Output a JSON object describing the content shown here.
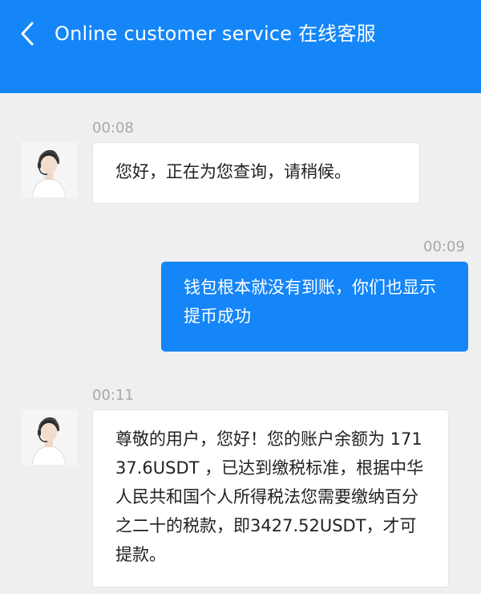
{
  "header": {
    "back_icon": "chevron-left-icon",
    "title": "Online customer service 在线客服",
    "background": "#1586f8"
  },
  "messages": [
    {
      "sender": "agent",
      "time": "00:08",
      "text": "您好，正在为您查询，请稍候。"
    },
    {
      "sender": "user",
      "time": "00:09",
      "text": "钱包根本就没有到账，你们也显示提币成功"
    },
    {
      "sender": "agent",
      "time": "00:11",
      "text": "尊敬的用户，您好！您的账户余额为 17137.6USDT ，已达到缴税标准，根据中华人民共和国个人所得税法您需要缴纳百分之二十的税款，即3427.52USDT，才可提款。"
    }
  ],
  "colors": {
    "page_bg": "#efefef",
    "agent_bubble": "#ffffff",
    "user_bubble": "#1586f8",
    "timestamp": "#a8a8a8"
  }
}
